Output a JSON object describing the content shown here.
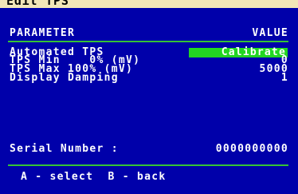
{
  "title": "Edit TPS",
  "header": {
    "parameter": "PARAMETER",
    "value": "VALUE"
  },
  "rows": [
    {
      "label": "Automated TPS",
      "value": "Calibrate"
    },
    {
      "label": "TPS Min    0% (mV)",
      "value": "0"
    },
    {
      "label": "TPS Max 100% (mV)",
      "value": "5000"
    },
    {
      "label": "Display Damping",
      "value": "1"
    }
  ],
  "serial": {
    "label": "Serial Number :",
    "value": "0000000000"
  },
  "footer": {
    "hint": "A - select  B - back"
  },
  "colors": {
    "screen_bg": "#0000aa",
    "title_bar": "#f2e6b8",
    "divider": "#36c236",
    "highlight": "#22d622",
    "text": "#ffffff"
  }
}
